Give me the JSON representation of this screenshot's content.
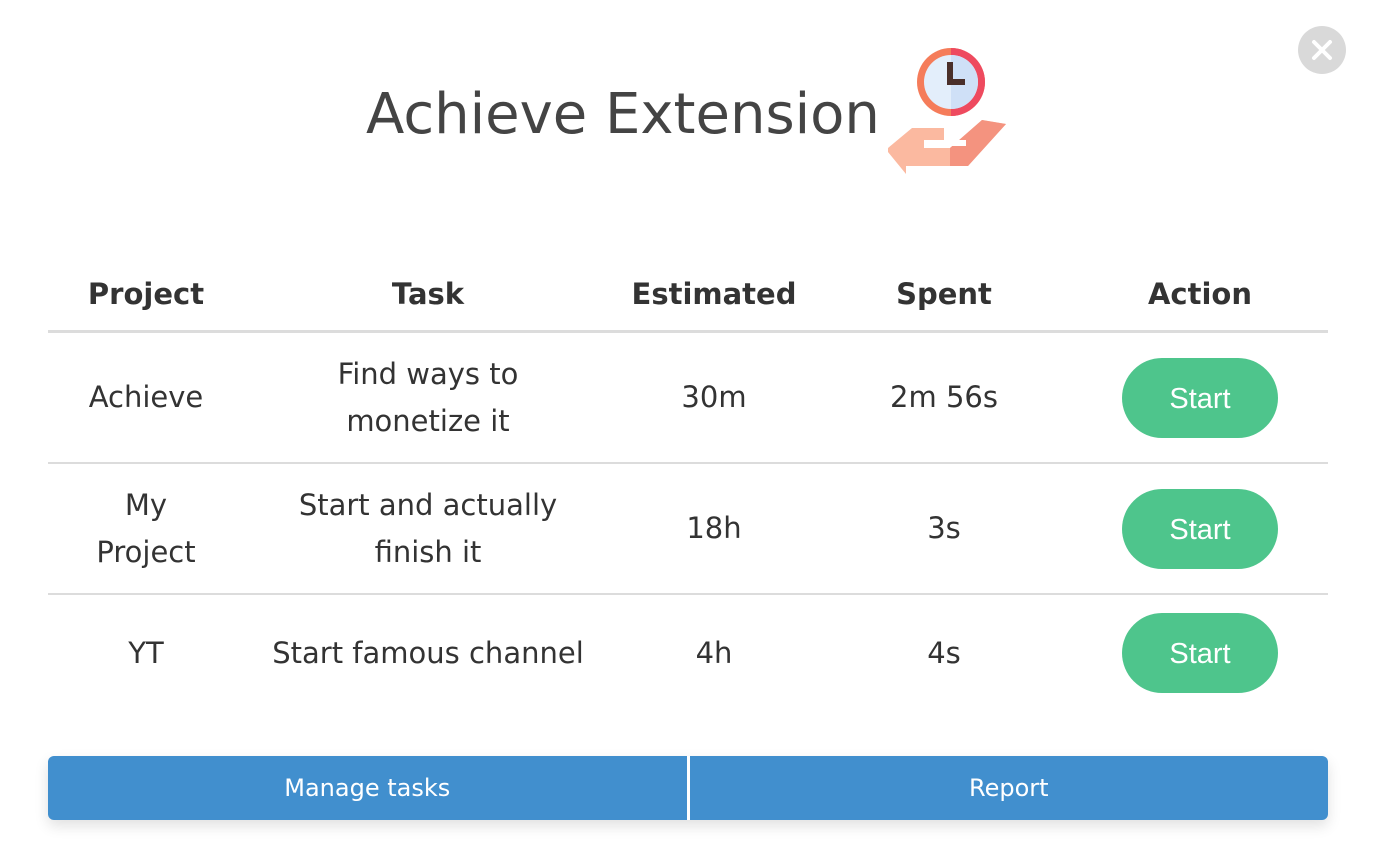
{
  "app": {
    "title": "Achieve Extension"
  },
  "icons": {
    "close": "close-icon",
    "logo": "hand-clock-icon"
  },
  "colors": {
    "start_button": "#4ec58c",
    "footer_button": "#418fce",
    "close_button": "#d9d9d9"
  },
  "table": {
    "headers": [
      "Project",
      "Task",
      "Estimated",
      "Spent",
      "Action"
    ],
    "rows": [
      {
        "project": "Achieve",
        "task": "Find ways to monetize it",
        "estimated": "30m",
        "spent": "2m 56s",
        "action": "Start"
      },
      {
        "project": "My Project",
        "task": "Start and actually finish it",
        "estimated": "18h",
        "spent": "3s",
        "action": "Start"
      },
      {
        "project": "YT",
        "task": "Start famous channel",
        "estimated": "4h",
        "spent": "4s",
        "action": "Start"
      }
    ]
  },
  "footer": {
    "manage_label": "Manage tasks",
    "report_label": "Report"
  }
}
